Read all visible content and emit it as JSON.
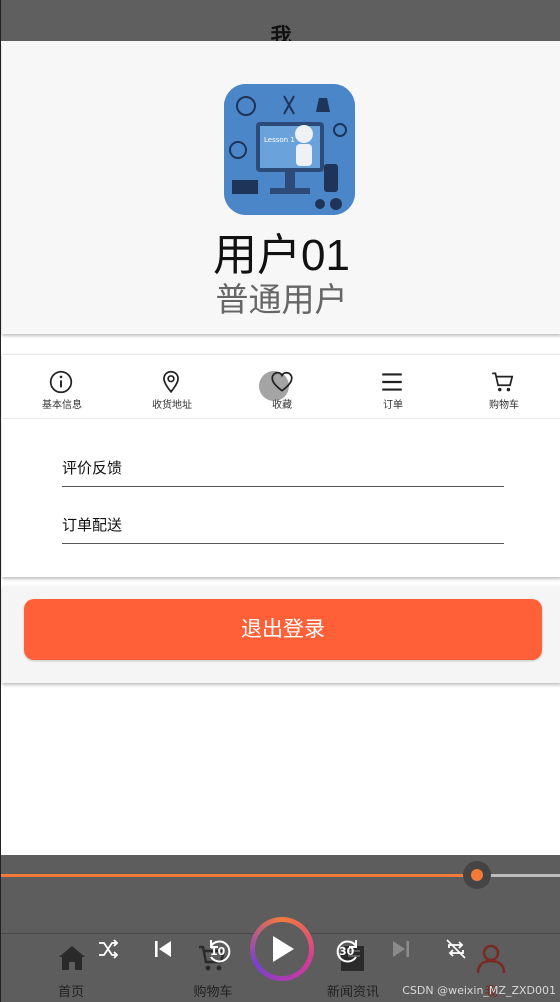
{
  "header": {
    "title": "我"
  },
  "profile": {
    "username": "用户01",
    "role": "普通用户",
    "avatar_text": "Lesson 1"
  },
  "shortcuts": [
    {
      "label": "基本信息",
      "icon": "info-icon"
    },
    {
      "label": "收货地址",
      "icon": "location-pin-icon"
    },
    {
      "label": "收藏",
      "icon": "heart-icon"
    },
    {
      "label": "订单",
      "icon": "menu-icon"
    },
    {
      "label": "购物车",
      "icon": "cart-icon"
    }
  ],
  "menu": [
    {
      "label": "评价反馈"
    },
    {
      "label": "订单配送"
    }
  ],
  "logout": {
    "label": "退出登录"
  },
  "bottom_nav": [
    {
      "label": "首页",
      "icon": "home-icon"
    },
    {
      "label": "购物车",
      "icon": "cart-icon"
    },
    {
      "label": "新闻资讯",
      "icon": "news-icon"
    },
    {
      "label": "我",
      "icon": "user-icon"
    }
  ],
  "media": {
    "progress": 0.85,
    "rewind_seconds": "10",
    "forward_seconds": "30"
  },
  "watermark": "CSDN @weixin_MZ_ZXD001",
  "colors": {
    "accent": "#ff6037",
    "seek": "#f47a3a",
    "overlay": "#5d5d5d"
  }
}
